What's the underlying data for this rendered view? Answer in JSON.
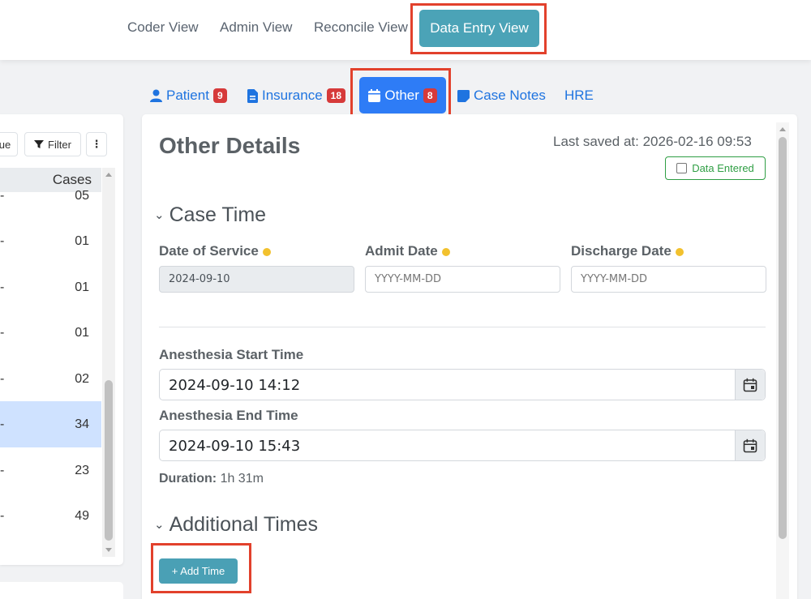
{
  "top_nav": {
    "items": [
      "Coder View",
      "Admin View",
      "Reconcile View"
    ],
    "active": "Data Entry View"
  },
  "left_panel": {
    "buttons": {
      "partial": "ue",
      "filter": "Filter",
      "more": "⋮"
    },
    "column_header": "Cases",
    "rows": [
      {
        "dash": "-",
        "count": "05"
      },
      {
        "dash": "-",
        "count": "01"
      },
      {
        "dash": "-",
        "count": "01"
      },
      {
        "dash": "-",
        "count": "01"
      },
      {
        "dash": "-",
        "count": "02"
      },
      {
        "dash": "-",
        "count": "34",
        "selected": true
      },
      {
        "dash": "-",
        "count": "23"
      },
      {
        "dash": "-",
        "count": "49"
      }
    ]
  },
  "sub_tabs": [
    {
      "label": "Patient",
      "badge": "9",
      "icon": "person-icon"
    },
    {
      "label": "Insurance",
      "badge": "18",
      "icon": "document-icon"
    },
    {
      "label": "Other",
      "badge": "8",
      "icon": "calendar-icon",
      "active": true
    },
    {
      "label": "Case Notes",
      "icon": "note-icon"
    },
    {
      "label": "HRE"
    }
  ],
  "main": {
    "title": "Other Details",
    "last_saved": "Last saved at: 2026-02-16 09:53",
    "data_entered_label": "Data Entered",
    "case_time": {
      "heading": "Case Time",
      "date_of_service": {
        "label": "Date of Service",
        "value": "2024-09-10"
      },
      "admit_date": {
        "label": "Admit Date",
        "placeholder": "YYYY-MM-DD"
      },
      "discharge_date": {
        "label": "Discharge Date",
        "placeholder": "YYYY-MM-DD"
      }
    },
    "anesthesia_start": {
      "label": "Anesthesia Start Time",
      "value": "2024-09-10 14:12"
    },
    "anesthesia_end": {
      "label": "Anesthesia End Time",
      "value": "2024-09-10 15:43"
    },
    "duration_label": "Duration:",
    "duration_value": "1h 31m",
    "additional_times": {
      "heading": "Additional Times",
      "add_button": "+ Add Time"
    }
  },
  "colors": {
    "accent_teal": "#4ba3b7",
    "active_tab_blue": "#2e7cf6",
    "badge_red": "#d63a3a",
    "highlight_red": "#e2412c",
    "required_dot": "#f2c12e",
    "success_green": "#2f9e44"
  }
}
